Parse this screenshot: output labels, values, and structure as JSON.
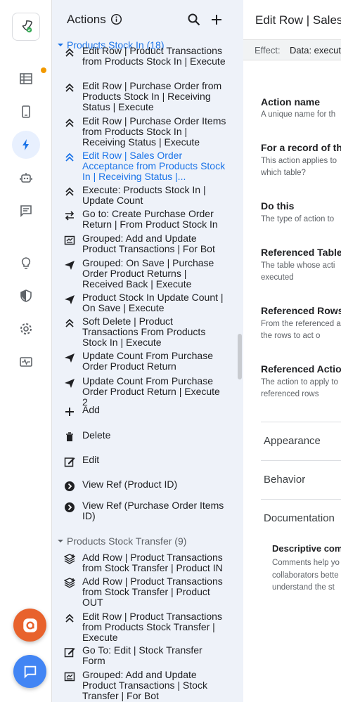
{
  "rail": {
    "items": [
      "rocket-logo",
      "tables",
      "mobile-view",
      "actions",
      "bots",
      "chat",
      "ideas",
      "security",
      "settings",
      "monitor"
    ]
  },
  "panel": {
    "title": "Actions",
    "groups": [
      {
        "label": "Products Stock In (18)",
        "items": [
          {
            "icon": "double-chevron-up",
            "label": "Edit Row | Product Transactions from Products Stock In | Execute"
          },
          {
            "icon": "double-chevron-up",
            "label": "Edit Row | Purchase Order from Products Stock In | Receiving Status | Execute"
          },
          {
            "icon": "double-chevron-up",
            "label": "Edit Row | Purchase Order Items from Products Stock In | Receiving Status | Execute"
          },
          {
            "icon": "double-chevron-up",
            "label": "Edit Row | Sales Order Acceptance from Products Stock In | Receiving Status |...",
            "selected": true
          },
          {
            "icon": "double-chevron-up",
            "label": "Execute: Products Stock In | Update Count"
          },
          {
            "icon": "swap",
            "label": "Go to: Create Purchase Order Return | From Product Stock In"
          },
          {
            "icon": "grouped",
            "label": "Grouped: Add and Update Product Transactions | For Bot"
          },
          {
            "icon": "send",
            "label": "Grouped: On Save | Purchase Order Product Returns | Received Back | Execute"
          },
          {
            "icon": "send",
            "label": "Product Stock In Update Count | On Save | Execute"
          },
          {
            "icon": "double-chevron-up",
            "label": "Soft Delete | Product Transactions From Products Stock In | Execute"
          },
          {
            "icon": "send",
            "label": "Update Count From Purchase Order Product Return"
          },
          {
            "icon": "send",
            "label": "Update Count From Purchase Order Product Return | Execute 2"
          },
          {
            "icon": "plus",
            "label": "Add"
          },
          {
            "icon": "trash",
            "label": "Delete"
          },
          {
            "icon": "edit",
            "label": "Edit"
          },
          {
            "icon": "arrow-circle",
            "label": "View Ref (Product ID)"
          },
          {
            "icon": "arrow-circle",
            "label": "View Ref (Purchase Order Items ID)"
          }
        ]
      },
      {
        "label": "Products Stock Transfer (9)",
        "items": [
          {
            "icon": "add-rows",
            "label": "Add Row | Product Transactions from Stock Transfer | Product IN"
          },
          {
            "icon": "add-rows",
            "label": "Add Row | Product Transactions from Stock Transfer | Product OUT"
          },
          {
            "icon": "double-chevron-up",
            "label": "Edit Row | Product Transactions from Products Stock Transfer | Execute"
          },
          {
            "icon": "edit",
            "label": "Go To: Edit | Stock Transfer Form"
          },
          {
            "icon": "grouped",
            "label": "Grouped: Add and Update Product Transactions | Stock Transfer | For Bot"
          }
        ]
      }
    ]
  },
  "detail": {
    "title": "Edit Row | Sales Order Acceptance from Products Stock In | Receiving Status",
    "effect_label": "Effect:",
    "effect_value": "Data: execute an action on a set of rows",
    "fields": [
      {
        "label": "Action name",
        "desc": "A unique name for th"
      },
      {
        "label": "For a record of thi",
        "desc": "This action applies to which table?"
      },
      {
        "label": "Do this",
        "desc": "The type of action to"
      },
      {
        "label": "Referenced Table",
        "desc": "The table whose acti executed"
      },
      {
        "label": "Referenced Rows",
        "desc": "From the referenced are the rows to act o"
      },
      {
        "label": "Referenced Action",
        "desc": "The action to apply to referenced rows"
      }
    ],
    "sections": [
      "Appearance",
      "Behavior",
      "Documentation"
    ],
    "doc_label": "Descriptive com",
    "doc_desc": "Comments help yo collaborators bette understand the st"
  },
  "colors": {
    "accent": "#1a73e8",
    "panel_bg": "#eef2f9",
    "fab_orange": "#e8622c",
    "fab_blue": "#4285f4"
  }
}
